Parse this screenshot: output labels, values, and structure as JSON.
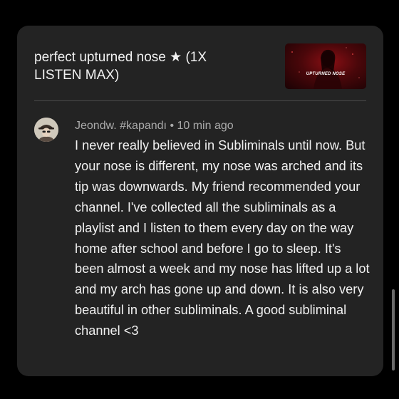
{
  "video": {
    "title": "perfect upturned nose ★ (1X LISTEN MAX)",
    "thumbnail_text": "UPTURNED NOSE"
  },
  "comment": {
    "author": "Jeondw. #kapandı",
    "separator": "•",
    "time": "10 min ago",
    "meta": "Jeondw. #kapandı • 10 min ago",
    "text": "I never really believed in Subliminals until now. But your nose is different, my nose was arched and its tip was downwards. My friend recommended your channel. I've collected all the subliminals as a playlist and I listen to them every day on the way home after school and before I go to sleep. It's been almost a week and my nose has lifted up a lot and my arch has gone up and down. It is also very beautiful in other subliminals. A good subliminal channel <3"
  },
  "colors": {
    "background": "#000000",
    "card": "#232323",
    "primary_text": "#f1f1f1",
    "secondary_text": "#aaaaaa",
    "thumbnail_accent": "#8a0f14"
  },
  "icons": {
    "avatar": "user-avatar",
    "scrollbar": "scrollbar-thumb"
  }
}
